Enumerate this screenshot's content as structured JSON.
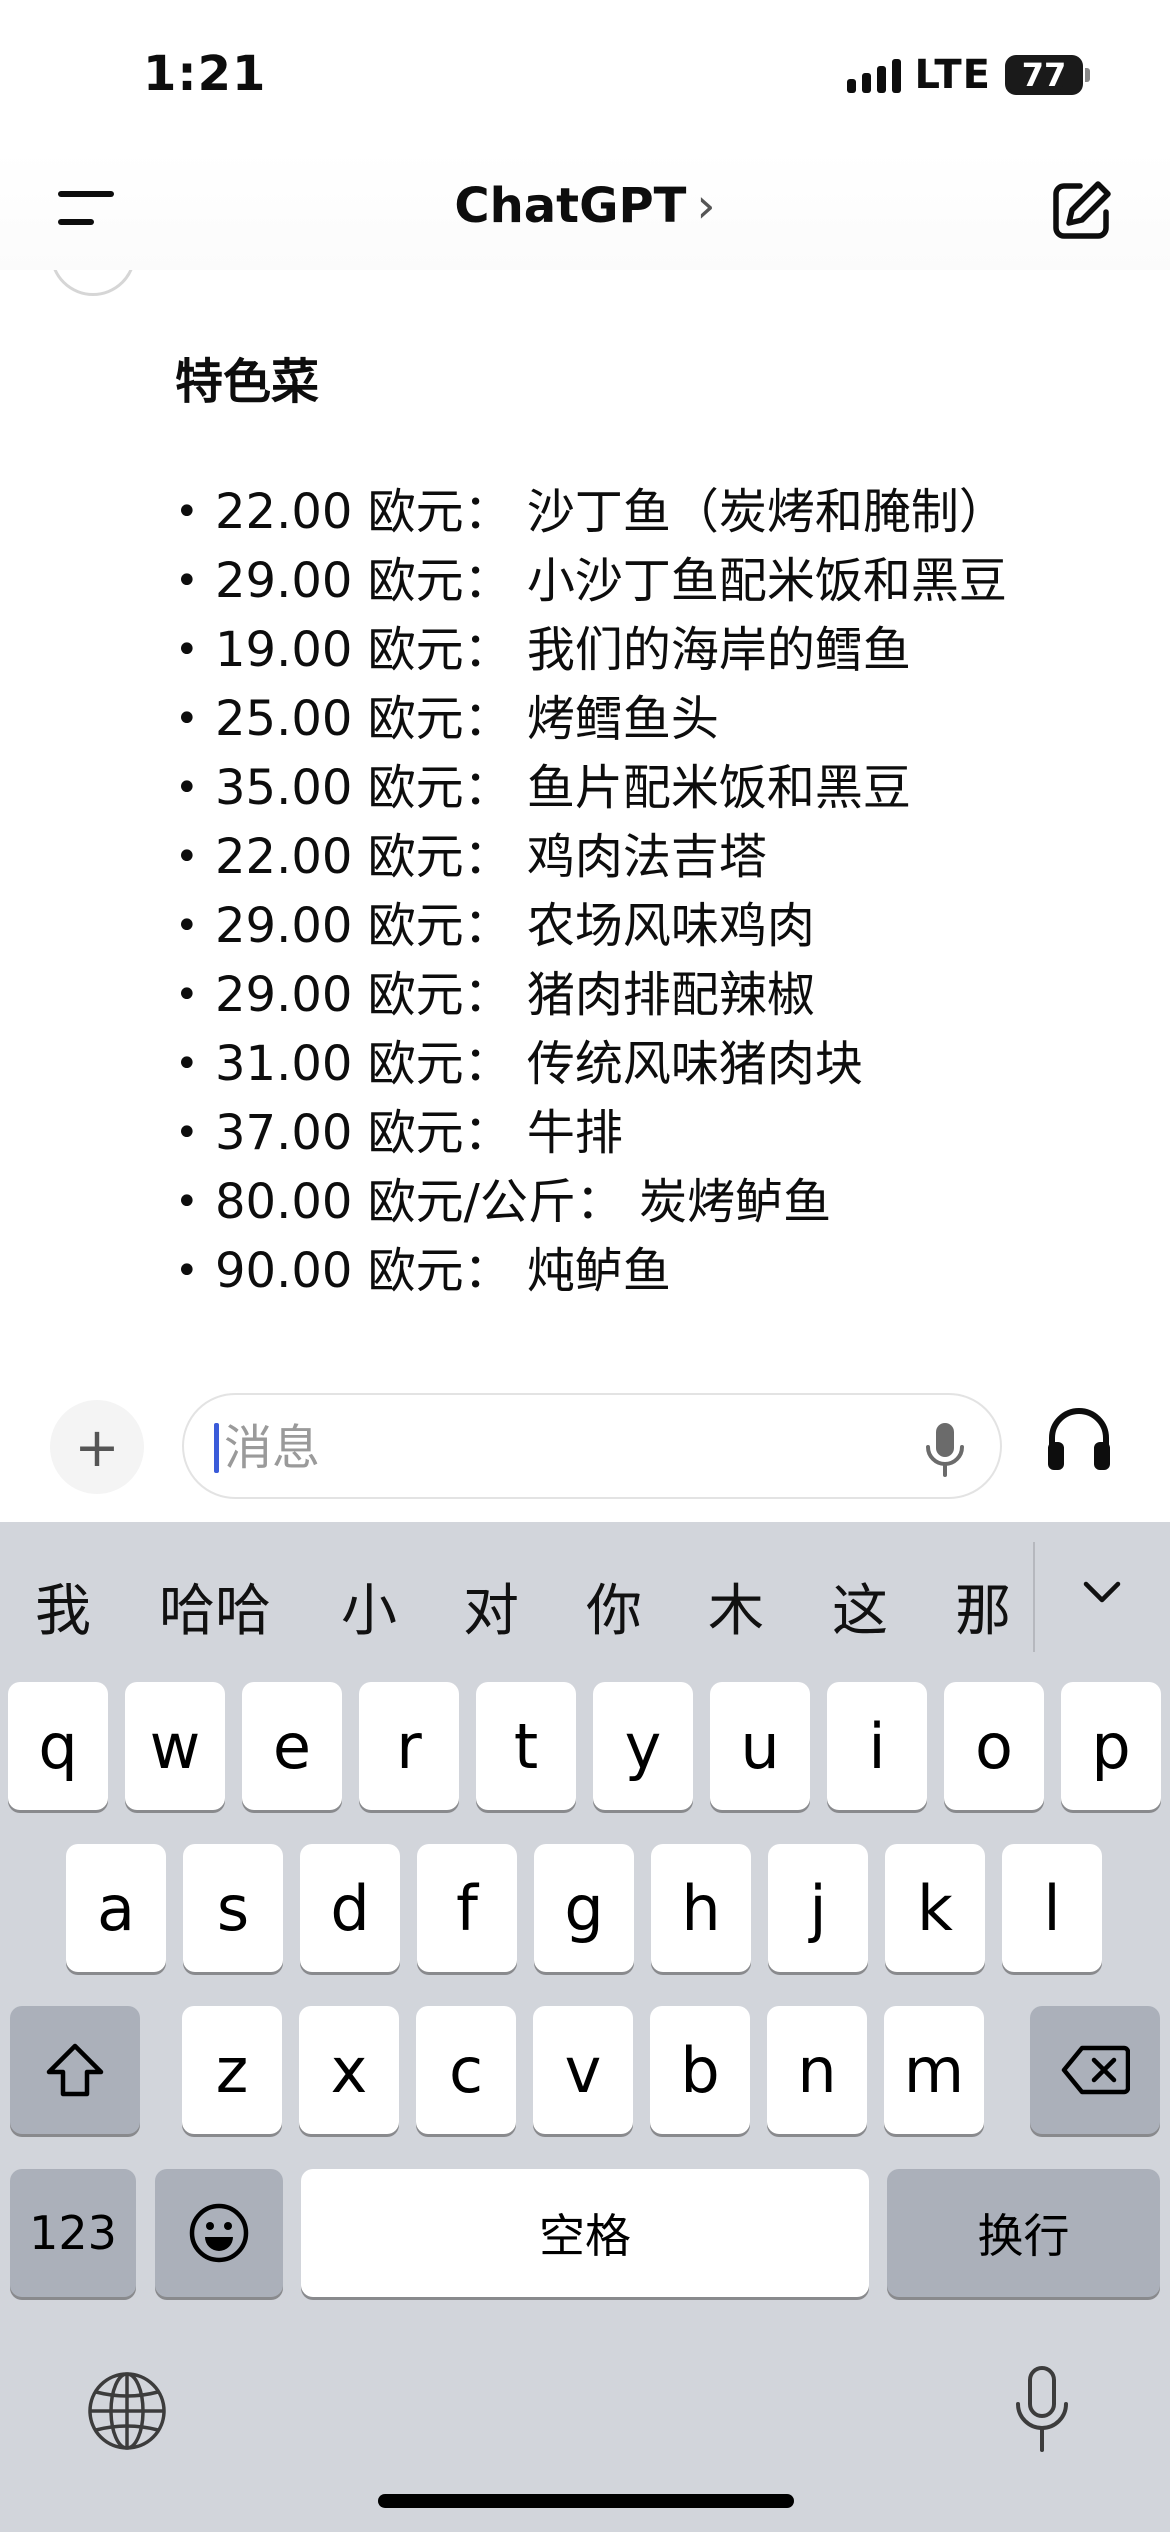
{
  "status_bar": {
    "time": "1:21",
    "network": "LTE",
    "battery": "77",
    "battery_percent": 77
  },
  "nav": {
    "title": "ChatGPT",
    "chevron": "›",
    "menu_icon": "menu-icon",
    "new_chat_icon": "compose-icon"
  },
  "message": {
    "section_title": "特色菜",
    "items": [
      "22.00 欧元： 沙丁鱼（炭烤和腌制）",
      "29.00 欧元： 小沙丁鱼配米饭和黑豆",
      "19.00 欧元： 我们的海岸的鳕鱼",
      "25.00 欧元： 烤鳕鱼头",
      "35.00 欧元： 鱼片配米饭和黑豆",
      "22.00 欧元： 鸡肉法吉塔",
      "29.00 欧元： 农场风味鸡肉",
      "29.00 欧元： 猪肉排配辣椒",
      "31.00 欧元： 传统风味猪肉块",
      "37.00 欧元： 牛排",
      "80.00 欧元/公斤： 炭烤鲈鱼",
      "90.00 欧元： 炖鲈鱼"
    ]
  },
  "composer": {
    "plus_label": "+",
    "placeholder": "消息",
    "value": ""
  },
  "keyboard": {
    "suggestions": [
      "我",
      "哈哈",
      "小",
      "对",
      "你",
      "木",
      "这",
      "那"
    ],
    "row1": [
      "q",
      "w",
      "e",
      "r",
      "t",
      "y",
      "u",
      "i",
      "o",
      "p"
    ],
    "row2": [
      "a",
      "s",
      "d",
      "f",
      "g",
      "h",
      "j",
      "k",
      "l"
    ],
    "row3": [
      "z",
      "x",
      "c",
      "v",
      "b",
      "n",
      "m"
    ],
    "numbers_label": "123",
    "space_label": "空格",
    "return_label": "换行"
  }
}
